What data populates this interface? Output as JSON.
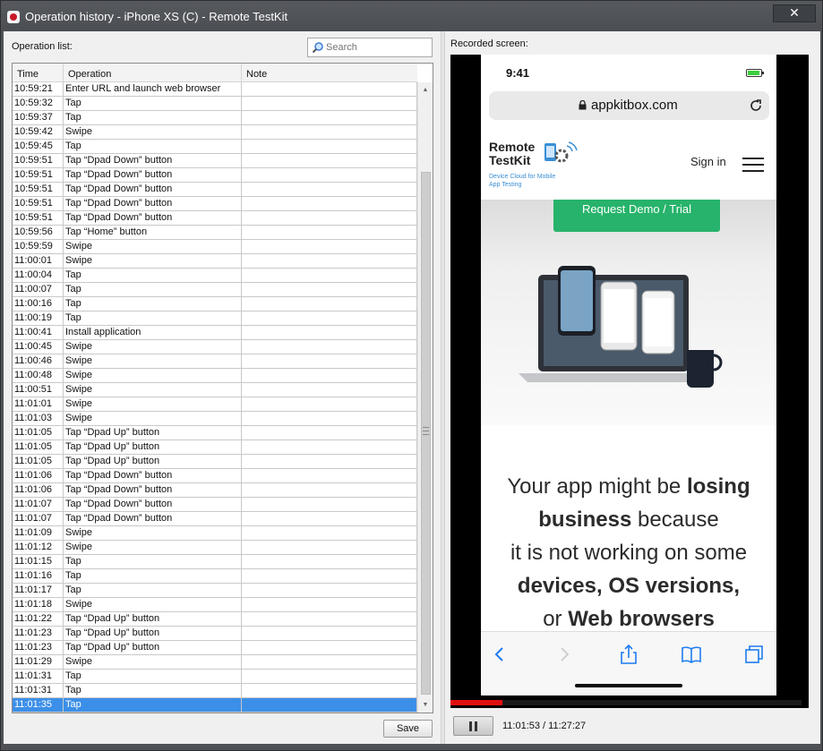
{
  "window": {
    "title": "Operation history - iPhone XS (C) - Remote TestKit",
    "close": "✕"
  },
  "left": {
    "label": "Operation list:",
    "search": {
      "placeholder": "Search",
      "value": ""
    },
    "columns": [
      "Time",
      "Operation",
      "Note"
    ],
    "rows": [
      {
        "time": "10:59:21",
        "op": "Enter URL and launch web browser",
        "note": ""
      },
      {
        "time": "10:59:32",
        "op": "Tap",
        "note": ""
      },
      {
        "time": "10:59:37",
        "op": "Tap",
        "note": ""
      },
      {
        "time": "10:59:42",
        "op": "Swipe",
        "note": ""
      },
      {
        "time": "10:59:45",
        "op": "Tap",
        "note": ""
      },
      {
        "time": "10:59:51",
        "op": "Tap “Dpad Down” button",
        "note": ""
      },
      {
        "time": "10:59:51",
        "op": "Tap “Dpad Down” button",
        "note": ""
      },
      {
        "time": "10:59:51",
        "op": "Tap “Dpad Down” button",
        "note": ""
      },
      {
        "time": "10:59:51",
        "op": "Tap “Dpad Down” button",
        "note": ""
      },
      {
        "time": "10:59:51",
        "op": "Tap “Dpad Down” button",
        "note": ""
      },
      {
        "time": "10:59:56",
        "op": "Tap “Home” button",
        "note": ""
      },
      {
        "time": "10:59:59",
        "op": "Swipe",
        "note": ""
      },
      {
        "time": "11:00:01",
        "op": "Swipe",
        "note": ""
      },
      {
        "time": "11:00:04",
        "op": "Tap",
        "note": ""
      },
      {
        "time": "11:00:07",
        "op": "Tap",
        "note": ""
      },
      {
        "time": "11:00:16",
        "op": "Tap",
        "note": ""
      },
      {
        "time": "11:00:19",
        "op": "Tap",
        "note": ""
      },
      {
        "time": "11:00:41",
        "op": "Install application",
        "note": ""
      },
      {
        "time": "11:00:45",
        "op": "Swipe",
        "note": ""
      },
      {
        "time": "11:00:46",
        "op": "Swipe",
        "note": ""
      },
      {
        "time": "11:00:48",
        "op": "Swipe",
        "note": ""
      },
      {
        "time": "11:00:51",
        "op": "Swipe",
        "note": ""
      },
      {
        "time": "11:01:01",
        "op": "Swipe",
        "note": ""
      },
      {
        "time": "11:01:03",
        "op": "Swipe",
        "note": ""
      },
      {
        "time": "11:01:05",
        "op": "Tap “Dpad Up” button",
        "note": ""
      },
      {
        "time": "11:01:05",
        "op": "Tap “Dpad Up” button",
        "note": ""
      },
      {
        "time": "11:01:05",
        "op": "Tap “Dpad Up” button",
        "note": ""
      },
      {
        "time": "11:01:06",
        "op": "Tap “Dpad Down” button",
        "note": ""
      },
      {
        "time": "11:01:06",
        "op": "Tap “Dpad Down” button",
        "note": ""
      },
      {
        "time": "11:01:07",
        "op": "Tap “Dpad Down” button",
        "note": ""
      },
      {
        "time": "11:01:07",
        "op": "Tap “Dpad Down” button",
        "note": ""
      },
      {
        "time": "11:01:09",
        "op": "Swipe",
        "note": ""
      },
      {
        "time": "11:01:12",
        "op": "Swipe",
        "note": ""
      },
      {
        "time": "11:01:15",
        "op": "Tap",
        "note": ""
      },
      {
        "time": "11:01:16",
        "op": "Tap",
        "note": ""
      },
      {
        "time": "11:01:17",
        "op": "Tap",
        "note": ""
      },
      {
        "time": "11:01:18",
        "op": "Swipe",
        "note": ""
      },
      {
        "time": "11:01:22",
        "op": "Tap “Dpad Up” button",
        "note": ""
      },
      {
        "time": "11:01:23",
        "op": "Tap “Dpad Up” button",
        "note": ""
      },
      {
        "time": "11:01:23",
        "op": "Tap “Dpad Up” button",
        "note": ""
      },
      {
        "time": "11:01:29",
        "op": "Swipe",
        "note": ""
      },
      {
        "time": "11:01:31",
        "op": "Tap",
        "note": ""
      },
      {
        "time": "11:01:31",
        "op": "Tap",
        "note": ""
      },
      {
        "time": "11:01:35",
        "op": "Tap",
        "note": ""
      }
    ],
    "selected_index": 43,
    "save_label": "Save"
  },
  "right": {
    "label": "Recorded screen:",
    "phone": {
      "time": "9:41",
      "url": "appkitbox.com",
      "logo_line1": "Remote",
      "logo_line2": "TestKit",
      "logo_sub": "Device Cloud for Mobile App Testing",
      "sign_in": "Sign in",
      "demo_button": "Request Demo / Trial",
      "headline": [
        {
          "pre": "Your app might be ",
          "bold": "losing",
          "post": ""
        },
        {
          "pre": "",
          "bold": "business",
          "post": " because"
        },
        {
          "pre": "it is not working on some",
          "bold": "",
          "post": ""
        },
        {
          "pre": "",
          "bold": "devices, OS versions,",
          "post": ""
        },
        {
          "pre": "or ",
          "bold": "Web browsers",
          "post": ""
        }
      ]
    },
    "playback": {
      "position": "11:01:53",
      "duration": "11:27:27",
      "progress_fraction": 0.148,
      "display": "11:01:53 / 11:27:27"
    }
  },
  "colors": {
    "selection": "#3c8fe8",
    "progress": "#e01010",
    "demo_button": "#27b36b",
    "accent_blue": "#3a8fd4"
  },
  "icons": [
    "app-icon",
    "close-icon",
    "search-icon",
    "lock-icon",
    "reload-icon",
    "menu-icon",
    "back-icon",
    "forward-icon",
    "share-icon",
    "bookmarks-icon",
    "tabs-icon",
    "pause-icon"
  ]
}
